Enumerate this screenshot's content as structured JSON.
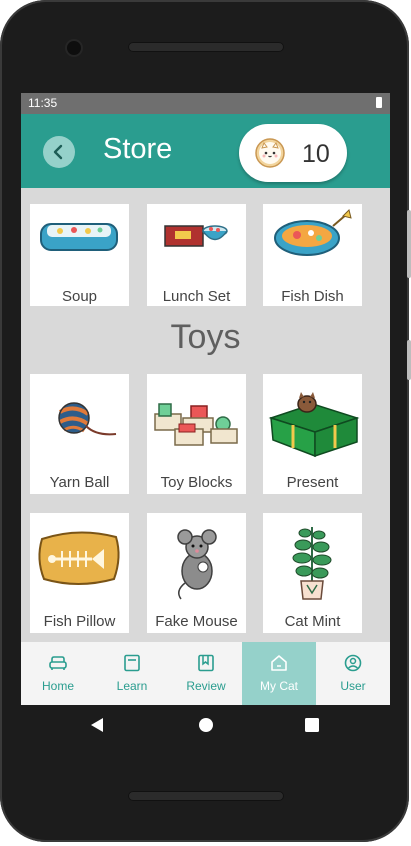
{
  "status": {
    "time": "11:35"
  },
  "header": {
    "title": "Store",
    "coins": "10",
    "back_icon": "chevron-left-icon",
    "coin_icon": "cat-face-coin-icon"
  },
  "food_items": [
    {
      "label": "Soup"
    },
    {
      "label": "Lunch Set"
    },
    {
      "label": "Fish Dish"
    }
  ],
  "toys_section": {
    "title": "Toys"
  },
  "toy_items": [
    {
      "label": "Yarn Ball"
    },
    {
      "label": "Toy Blocks"
    },
    {
      "label": "Present"
    },
    {
      "label": "Fish Pillow"
    },
    {
      "label": "Fake Mouse"
    },
    {
      "label": "Cat Mint"
    }
  ],
  "bottom_nav": [
    {
      "label": "Home",
      "icon": "sofa-icon"
    },
    {
      "label": "Learn",
      "icon": "book-icon"
    },
    {
      "label": "Review",
      "icon": "notebook-icon"
    },
    {
      "label": "My Cat",
      "icon": "house-icon",
      "active": true
    },
    {
      "label": "User",
      "icon": "user-icon"
    }
  ],
  "colors": {
    "accent": "#2a9d8f",
    "accent_light": "#95d1ca",
    "screen_bg": "#d9d9d9"
  }
}
